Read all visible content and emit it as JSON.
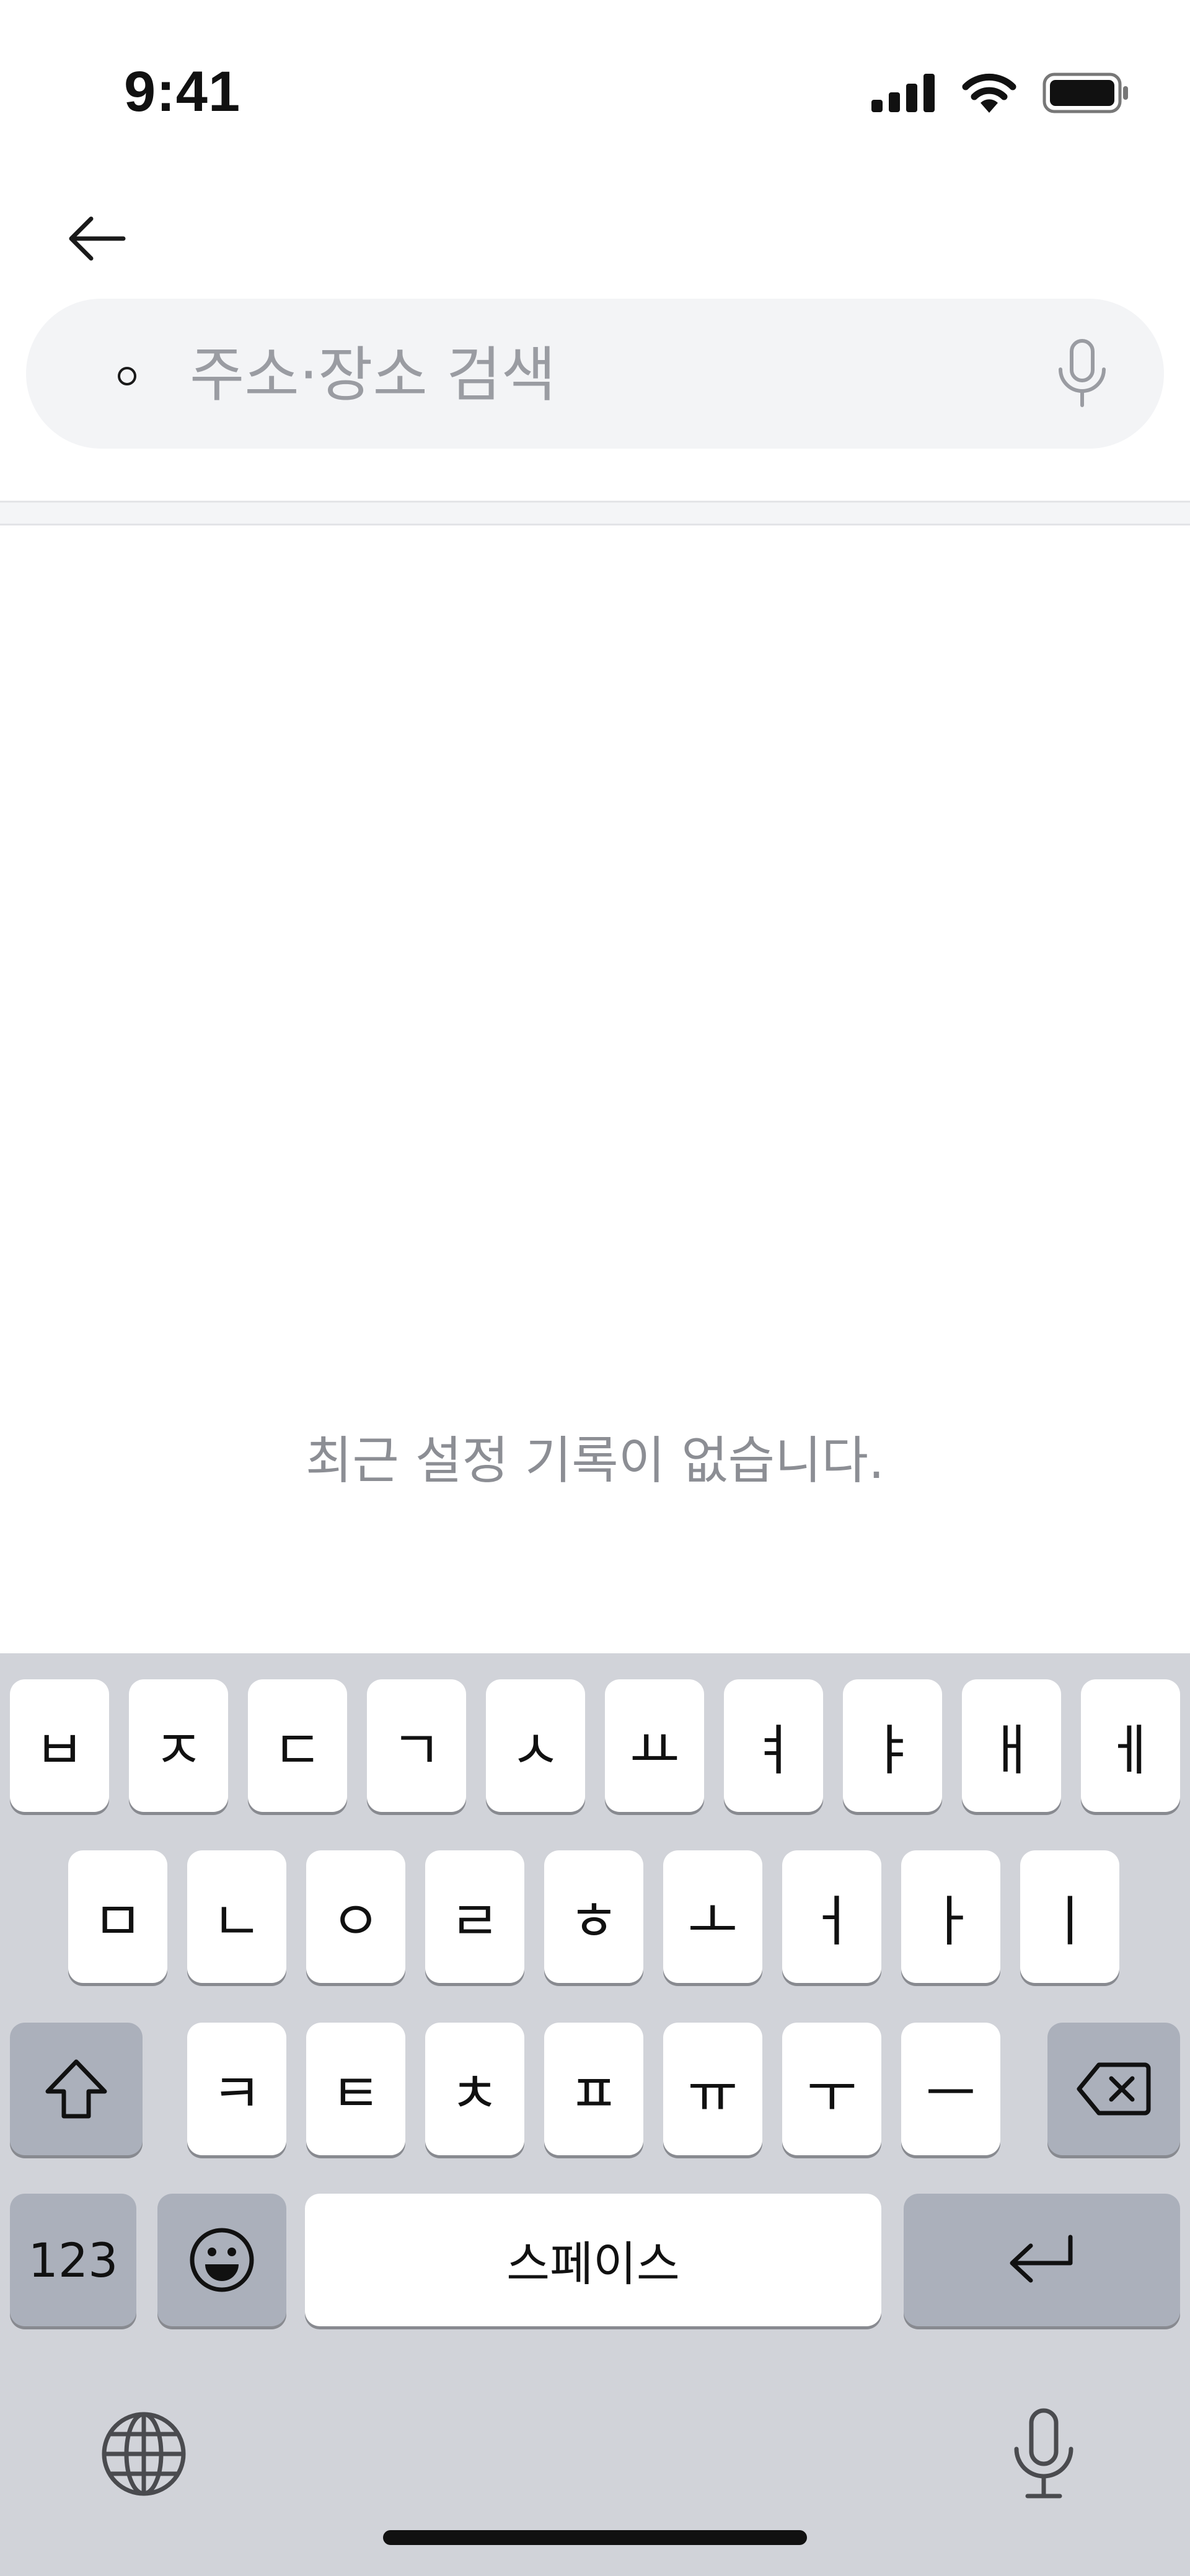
{
  "status_bar": {
    "time": "9:41"
  },
  "search": {
    "placeholder": "주소·장소 검색",
    "value": ""
  },
  "main": {
    "empty_message": "최근 설정 기록이 없습니다."
  },
  "keyboard": {
    "row1": [
      "ㅂ",
      "ㅈ",
      "ㄷ",
      "ㄱ",
      "ㅅ",
      "ㅛ",
      "ㅕ",
      "ㅑ",
      "ㅐ",
      "ㅔ"
    ],
    "row2": [
      "ㅁ",
      "ㄴ",
      "ㅇ",
      "ㄹ",
      "ㅎ",
      "ㅗ",
      "ㅓ",
      "ㅏ",
      "ㅣ"
    ],
    "row3": [
      "ㅋ",
      "ㅌ",
      "ㅊ",
      "ㅍ",
      "ㅠ",
      "ㅜ",
      "ㅡ"
    ],
    "numbers_label": "123",
    "space_label": "스페이스"
  },
  "icons": {
    "back": "arrow-left-icon",
    "search": "dot-icon",
    "mic": "microphone-icon",
    "shift": "shift-icon",
    "delete": "backspace-icon",
    "emoji": "emoji-icon",
    "return": "return-icon",
    "globe": "globe-icon",
    "dictation": "microphone-icon"
  },
  "colors": {
    "keyboard_bg": "#d1d3d9",
    "key_light": "#ffffff",
    "key_dark": "#abb0bb",
    "search_bg": "#f3f4f6"
  }
}
